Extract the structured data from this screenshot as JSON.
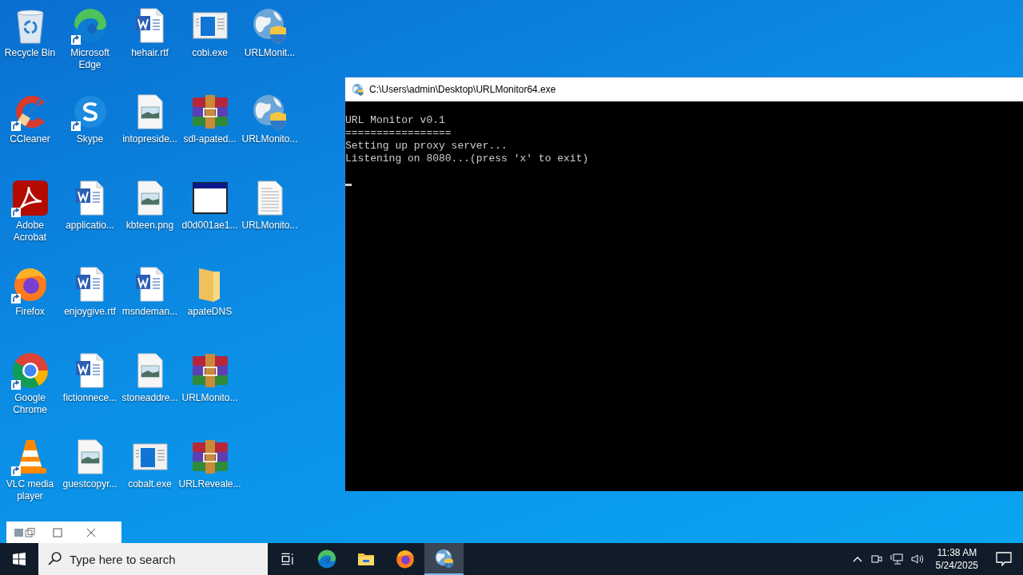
{
  "desktop": {
    "icons": [
      {
        "label": "Recycle Bin",
        "kind": "recycle",
        "shortcut": false
      },
      {
        "label": "CCleaner",
        "kind": "ccleaner",
        "shortcut": true
      },
      {
        "label": "Adobe Acrobat",
        "kind": "acrobat",
        "shortcut": true
      },
      {
        "label": "Firefox",
        "kind": "firefox",
        "shortcut": true
      },
      {
        "label": "Google Chrome",
        "kind": "chrome",
        "shortcut": true
      },
      {
        "label": "VLC media player",
        "kind": "vlc",
        "shortcut": true
      },
      {
        "label": "Microsoft Edge",
        "kind": "edge",
        "shortcut": true
      },
      {
        "label": "Skype",
        "kind": "skype",
        "shortcut": true
      },
      {
        "label": "applicatio...",
        "kind": "word",
        "shortcut": false
      },
      {
        "label": "enjoygive.rtf",
        "kind": "word",
        "shortcut": false
      },
      {
        "label": "fictionnece...",
        "kind": "word",
        "shortcut": false
      },
      {
        "label": "guestcopyr...",
        "kind": "image",
        "shortcut": false
      },
      {
        "label": "hehair.rtf",
        "kind": "word",
        "shortcut": false
      },
      {
        "label": "intopreside...",
        "kind": "image",
        "shortcut": false
      },
      {
        "label": "kbteen.png",
        "kind": "image",
        "shortcut": false
      },
      {
        "label": "msndeman...",
        "kind": "word",
        "shortcut": false
      },
      {
        "label": "stoneaddre...",
        "kind": "image",
        "shortcut": false
      },
      {
        "label": "cobalt.exe",
        "kind": "exe",
        "shortcut": false
      },
      {
        "label": "cobi.exe",
        "kind": "exe",
        "shortcut": false
      },
      {
        "label": "sdl-apated...",
        "kind": "rar",
        "shortcut": false
      },
      {
        "label": "d0d001ae1...",
        "kind": "window",
        "shortcut": false
      },
      {
        "label": "apateDNS",
        "kind": "folder",
        "shortcut": false
      },
      {
        "label": "URLMonito...",
        "kind": "rar",
        "shortcut": false
      },
      {
        "label": "URLReveale...",
        "kind": "rar",
        "shortcut": false
      },
      {
        "label": "URLMonit...",
        "kind": "globe",
        "shortcut": false
      },
      {
        "label": "URLMonito...",
        "kind": "globe",
        "shortcut": false
      },
      {
        "label": "URLMonito...",
        "kind": "text",
        "shortcut": false
      }
    ]
  },
  "console": {
    "title": "C:\\Users\\admin\\Desktop\\URLMonitor64.exe",
    "lines": [
      "URL Monitor v0.1",
      "=================",
      "Setting up proxy server...",
      "Listening on 8080...(press 'x' to exit)"
    ]
  },
  "taskbar": {
    "search": {
      "placeholder": "Type here to search"
    },
    "apps": [
      {
        "kind": "taskview",
        "selected": false
      },
      {
        "kind": "edge",
        "selected": false
      },
      {
        "kind": "explorer",
        "selected": false
      },
      {
        "kind": "firefox",
        "selected": false
      },
      {
        "kind": "globe",
        "selected": true
      }
    ],
    "time": "11:38 AM",
    "date": "5/24/2025"
  }
}
